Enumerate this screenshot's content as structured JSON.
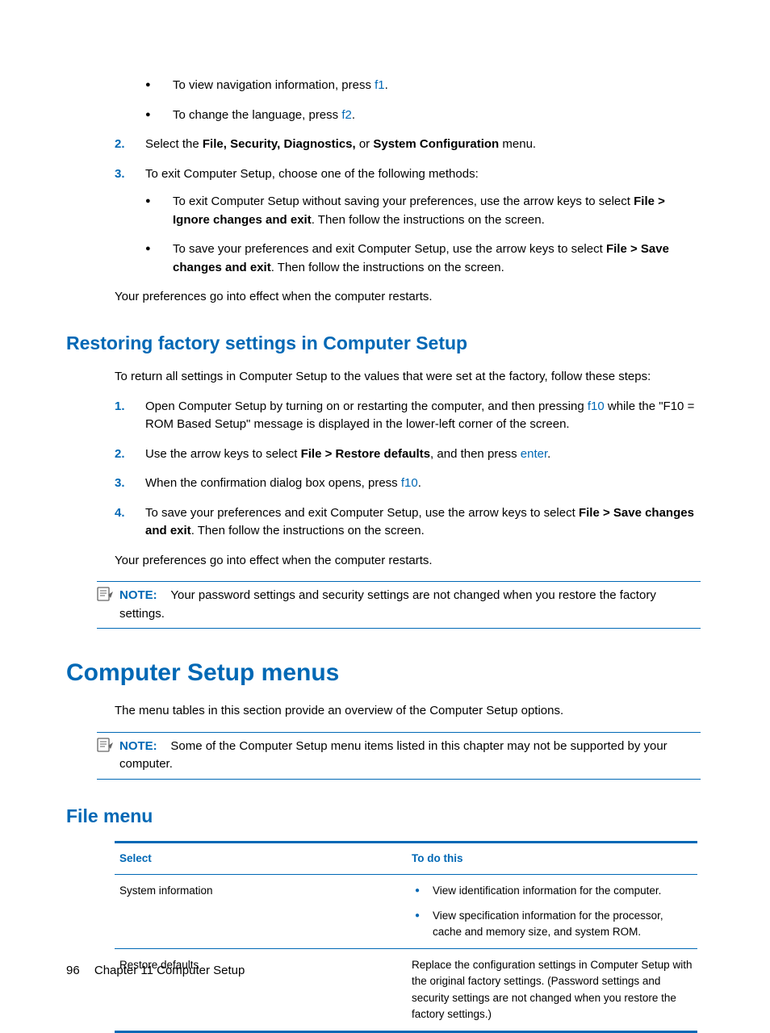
{
  "top_bullets": [
    {
      "prefix": "To view navigation information, press ",
      "key": "f1",
      "suffix": "."
    },
    {
      "prefix": "To change the language, press ",
      "key": "f2",
      "suffix": "."
    }
  ],
  "step2": {
    "num": "2.",
    "t1": "Select the ",
    "b1": "File, Security, Diagnostics,",
    "t2": " or ",
    "b2": "System Configuration",
    "t3": " menu."
  },
  "step3": {
    "num": "3.",
    "text": "To exit Computer Setup, choose one of the following methods:",
    "sub": [
      {
        "t1": "To exit Computer Setup without saving your preferences, use the arrow keys to select ",
        "b1": "File > Ignore changes and exit",
        "t2": ". Then follow the instructions on the screen."
      },
      {
        "t1": "To save your preferences and exit Computer Setup, use the arrow keys to select ",
        "b1": "File > Save changes and exit",
        "t2": ". Then follow the instructions on the screen."
      }
    ]
  },
  "prefs_effect": "Your preferences go into effect when the computer restarts.",
  "h_restore": "Restoring factory settings in Computer Setup",
  "restore_intro": "To return all settings in Computer Setup to the values that were set at the factory, follow these steps:",
  "rsteps": [
    {
      "num": "1.",
      "t1": "Open Computer Setup by turning on or restarting the computer, and then pressing ",
      "k1": "f10",
      "t2": " while the \"F10 = ROM Based Setup\" message is displayed in the lower-left corner of the screen."
    },
    {
      "num": "2.",
      "t1": "Use the arrow keys to select ",
      "b1": "File > Restore defaults",
      "t2": ", and then press ",
      "k1": "enter",
      "t3": "."
    },
    {
      "num": "3.",
      "t1": "When the confirmation dialog box opens, press ",
      "k1": "f10",
      "t2": "."
    },
    {
      "num": "4.",
      "t1": "To save your preferences and exit Computer Setup, use the arrow keys to select ",
      "b1": "File > Save changes and exit",
      "t2": ". Then follow the instructions on the screen."
    }
  ],
  "note1": {
    "label": "NOTE:",
    "text": "Your password settings and security settings are not changed when you restore the factory settings."
  },
  "h_menus": "Computer Setup menus",
  "menus_intro": "The menu tables in this section provide an overview of the Computer Setup options.",
  "note2": {
    "label": "NOTE:",
    "text": "Some of the Computer Setup menu items listed in this chapter may not be supported by your computer."
  },
  "h_filemenu": "File menu",
  "table": {
    "headers": [
      "Select",
      "To do this"
    ],
    "rows": [
      {
        "select": "System information",
        "bullets": [
          "View identification information for the computer.",
          "View specification information for the processor, cache and memory size, and system ROM."
        ]
      },
      {
        "select": "Restore defaults",
        "plain": "Replace the configuration settings in Computer Setup with the original factory settings. (Password settings and security settings are not changed when you restore the factory settings.)"
      }
    ]
  },
  "footer": {
    "page": "96",
    "chapter": "Chapter 11   Computer Setup"
  }
}
